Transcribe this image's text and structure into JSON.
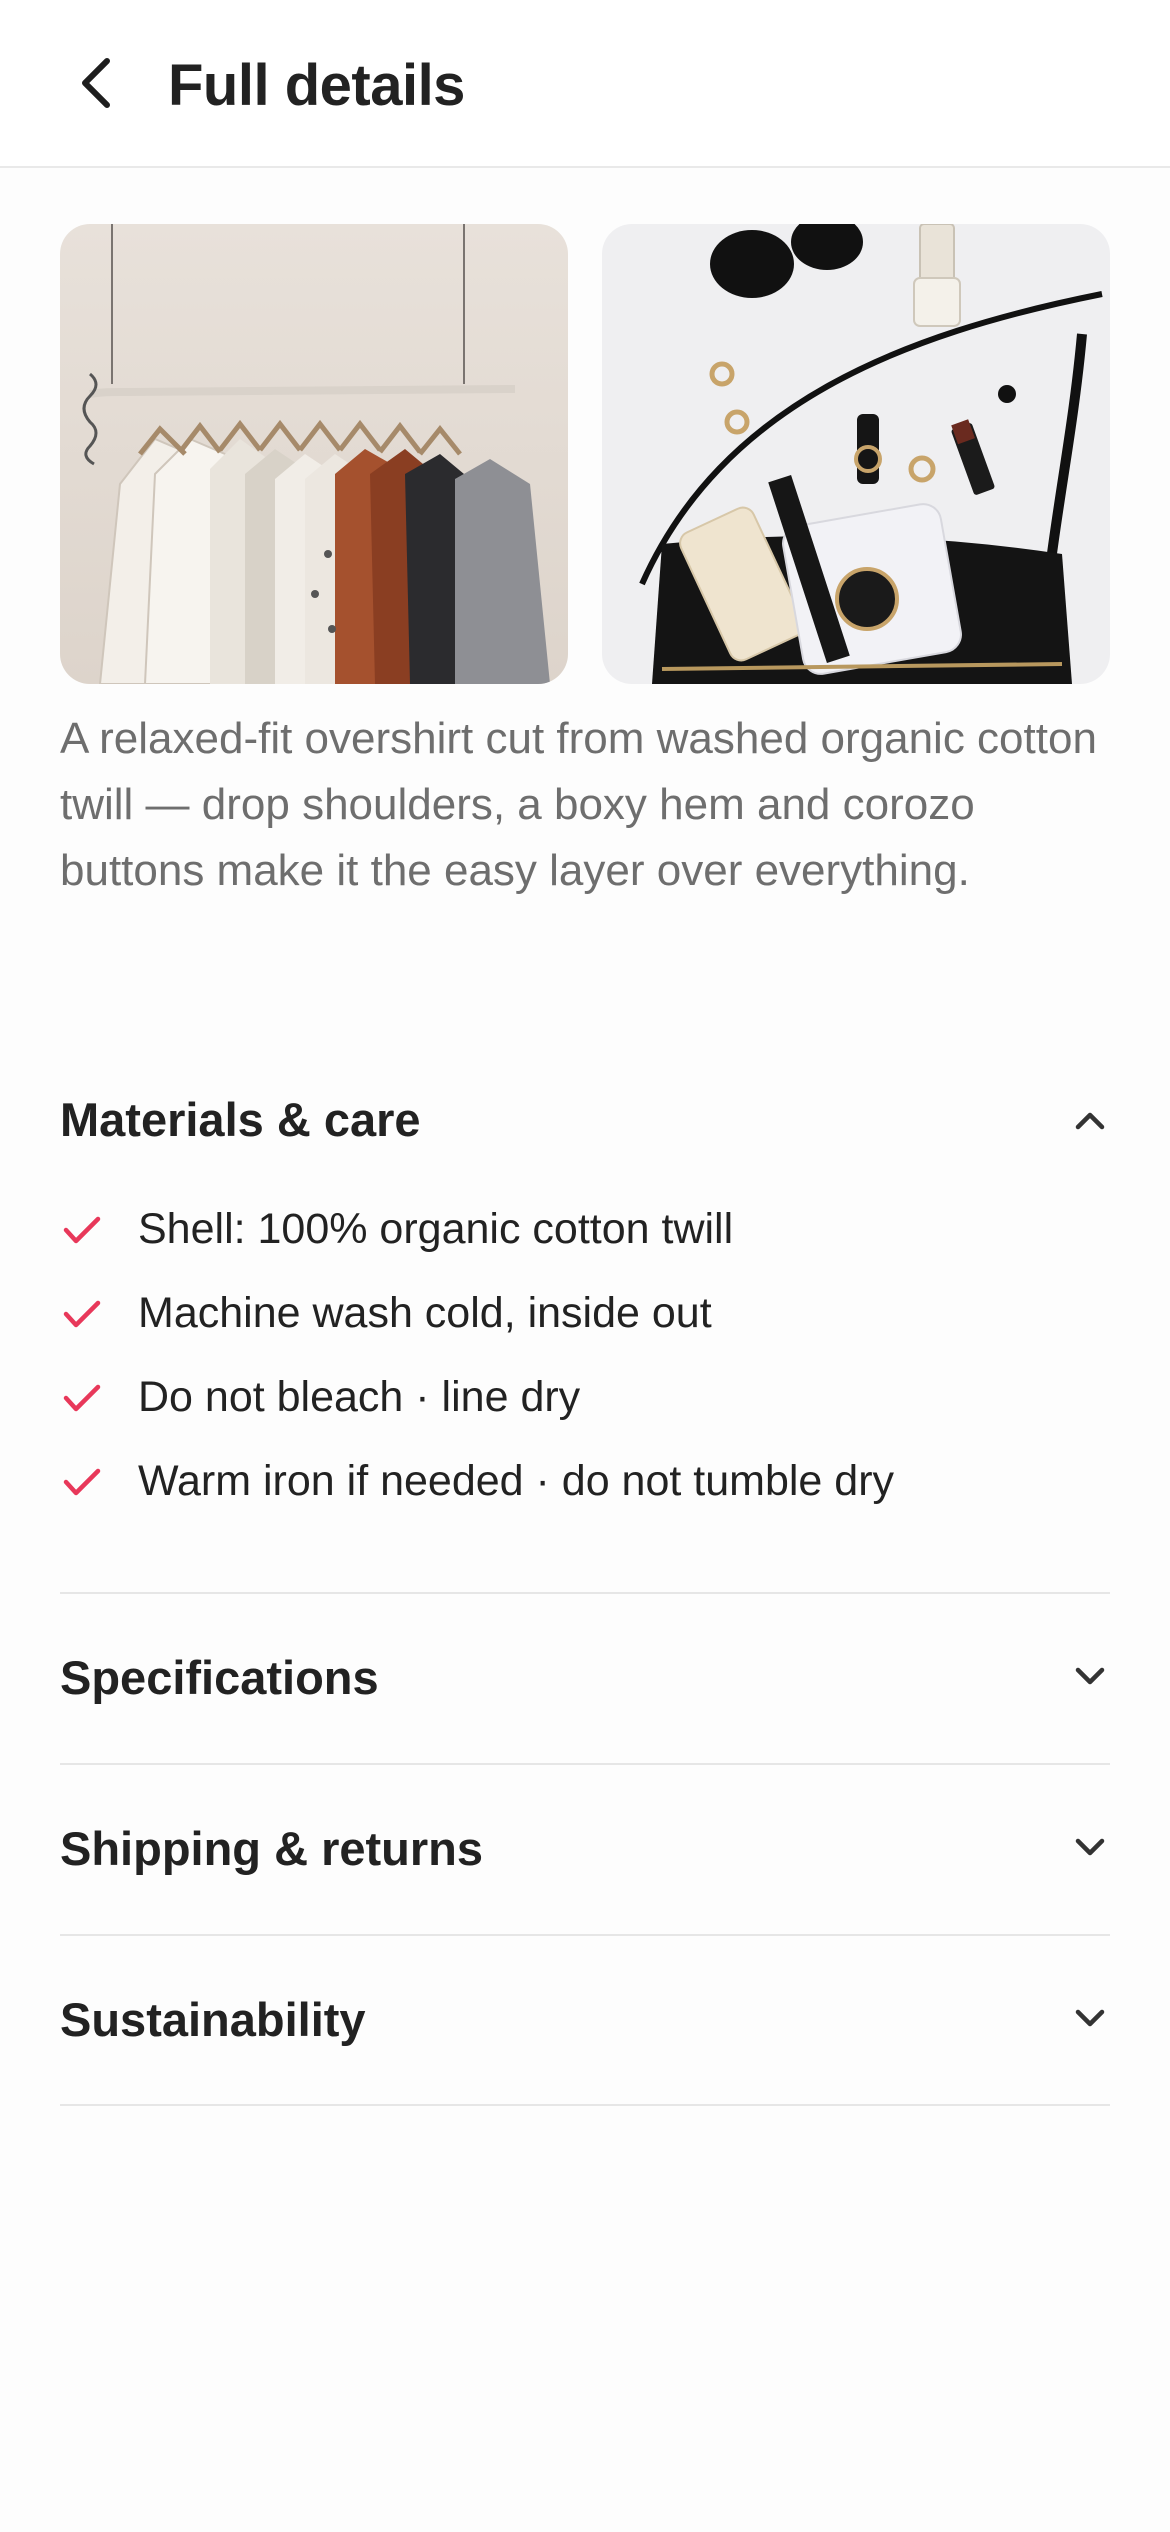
{
  "header": {
    "back_icon": "chevron-left-icon",
    "title": "Full details"
  },
  "gallery": {
    "images": [
      {
        "name": "clothing-rack-image",
        "alt": ""
      },
      {
        "name": "accessories-flatlay-image",
        "alt": ""
      }
    ]
  },
  "description": "A relaxed-fit overshirt cut from washed organic cotton twill — drop shoulders, a boxy hem and corozo buttons make it the easy layer over everything.",
  "materials": {
    "title": "Materials & care",
    "expanded": true,
    "icon": "chevron-up-icon",
    "check_color": "#e8385a",
    "items": [
      "Shell: 100% organic cotton twill",
      "Machine wash cold, inside out",
      "Do not bleach · line dry",
      "Warm iron if needed · do not tumble dry"
    ]
  },
  "sections": [
    {
      "title": "Specifications",
      "expanded": false,
      "icon": "chevron-down-icon"
    },
    {
      "title": "Shipping & returns",
      "expanded": false,
      "icon": "chevron-down-icon"
    },
    {
      "title": "Sustainability",
      "expanded": false,
      "icon": "chevron-down-icon"
    }
  ]
}
